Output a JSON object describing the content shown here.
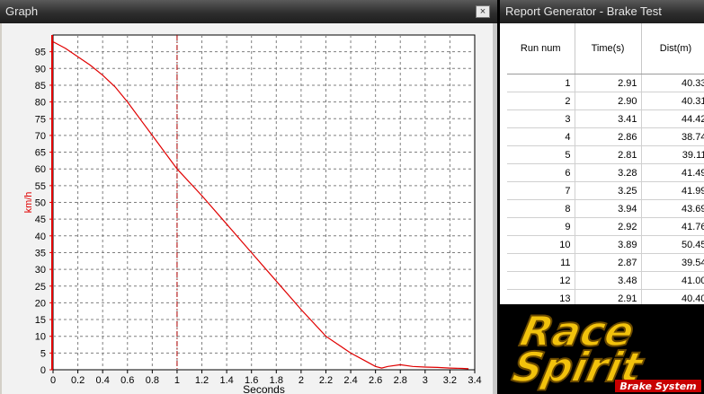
{
  "graph_window": {
    "title": "Graph",
    "close_glyph": "×"
  },
  "report_window": {
    "title": "Report Generator - Brake Test",
    "columns": [
      "Run num",
      "Time(s)",
      "Dist(m)"
    ],
    "rows": [
      [
        "1",
        "2.91",
        "40.33"
      ],
      [
        "2",
        "2.90",
        "40.31"
      ],
      [
        "3",
        "3.41",
        "44.42"
      ],
      [
        "4",
        "2.86",
        "38.74"
      ],
      [
        "5",
        "2.81",
        "39.11"
      ],
      [
        "6",
        "3.28",
        "41.49"
      ],
      [
        "7",
        "3.25",
        "41.99"
      ],
      [
        "8",
        "3.94",
        "43.69"
      ],
      [
        "9",
        "2.92",
        "41.76"
      ],
      [
        "10",
        "3.89",
        "50.45"
      ],
      [
        "11",
        "2.87",
        "39.54"
      ],
      [
        "12",
        "3.48",
        "41.00"
      ],
      [
        "13",
        "2.91",
        "40.40"
      ]
    ]
  },
  "logo": {
    "line1": "Race",
    "line2": "Spirit",
    "tagline": "Brake System"
  },
  "colors": {
    "series": "#e00000",
    "yaxis": "#e00000",
    "grid": "#7f7f7f",
    "plot_bg": "#ffffff"
  },
  "chart_data": {
    "type": "line",
    "xlabel": "Seconds",
    "ylabel": "km/h",
    "xlim": [
      0,
      3.4
    ],
    "ylim": [
      0,
      100
    ],
    "x_ticks": [
      "0",
      "0.2",
      "0.4",
      "0.6",
      "0.8",
      "1",
      "1.2",
      "1.4",
      "1.6",
      "1.8",
      "2",
      "2.2",
      "2.4",
      "2.6",
      "2.8",
      "3",
      "3.2",
      "3.4"
    ],
    "y_ticks": [
      "0",
      "5",
      "10",
      "15",
      "20",
      "25",
      "30",
      "35",
      "40",
      "45",
      "50",
      "55",
      "60",
      "65",
      "70",
      "75",
      "80",
      "85",
      "90",
      "95"
    ],
    "grid": true,
    "marker_x": 1,
    "series": [
      {
        "x": [
          0,
          0.1,
          0.2,
          0.3,
          0.4,
          0.5,
          0.6,
          0.7,
          0.8,
          0.9,
          1.0,
          1.2,
          1.4,
          1.6,
          1.8,
          2.0,
          2.2,
          2.4,
          2.5,
          2.6,
          2.65,
          2.7,
          2.8,
          2.9,
          3.0,
          3.1,
          3.2,
          3.3,
          3.35
        ],
        "y": [
          98,
          96,
          93.5,
          91,
          88,
          84.5,
          80,
          75,
          70,
          65,
          60,
          52,
          43.5,
          35,
          26.5,
          18,
          10,
          5,
          3,
          1,
          0.5,
          1,
          1.5,
          1,
          0.8,
          0.7,
          0.5,
          0.4,
          0.3
        ]
      }
    ]
  }
}
